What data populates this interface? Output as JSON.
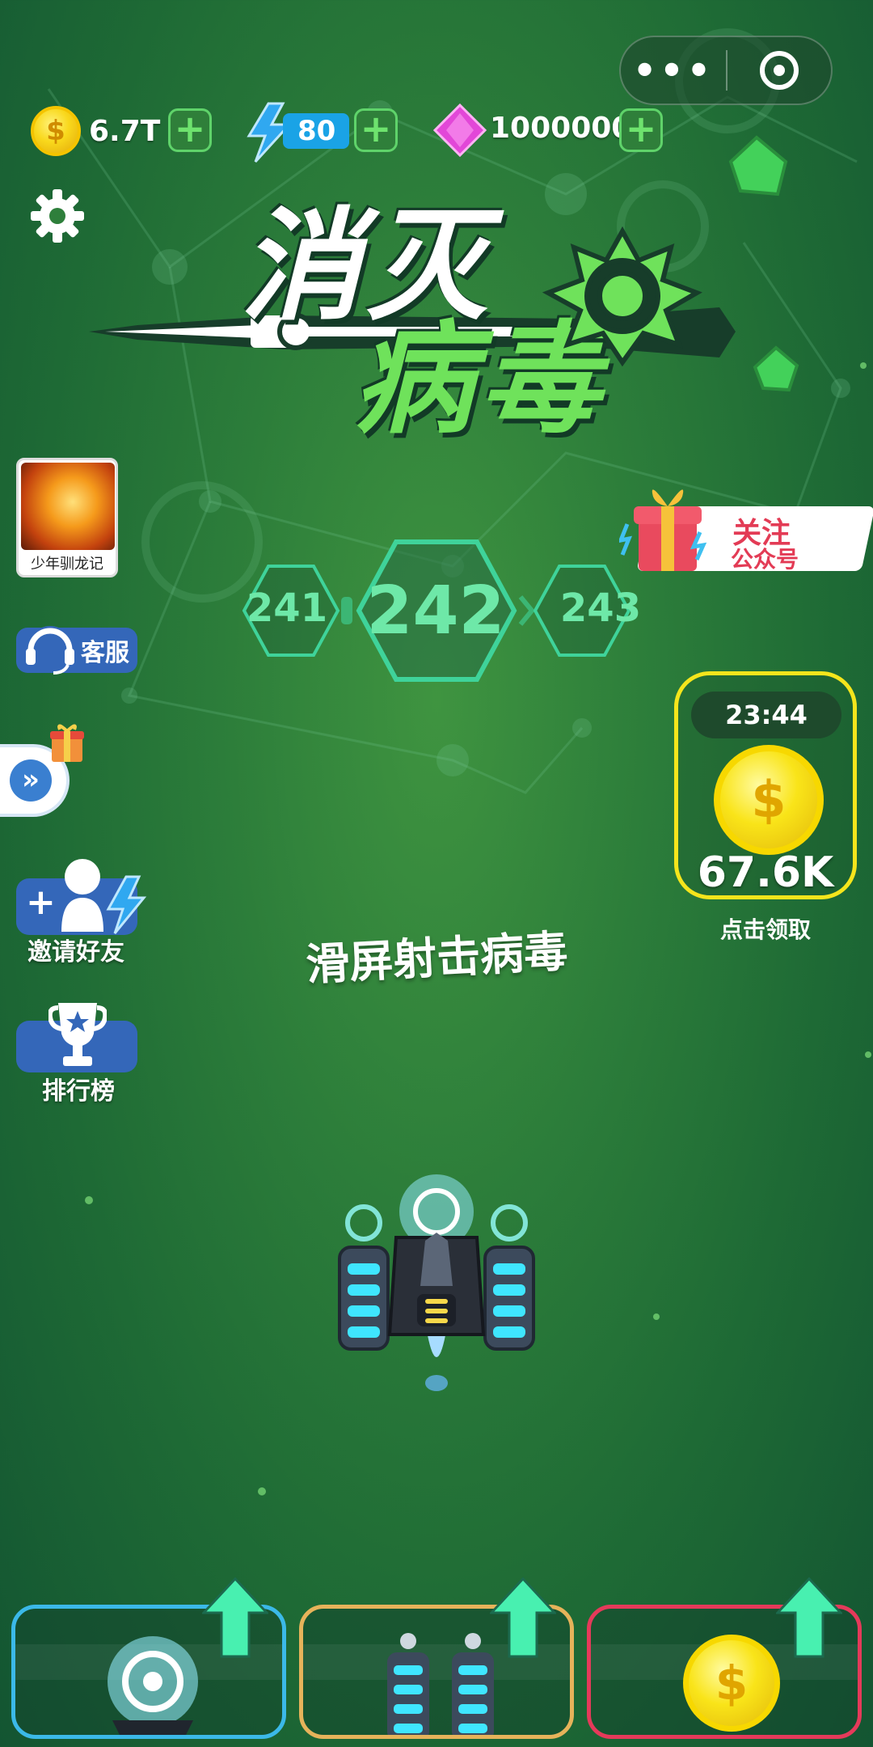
{
  "resources": {
    "coins": "6.7T",
    "energy": "80",
    "gems": "1000000"
  },
  "title": {
    "line1": "消灭",
    "line2": "病毒"
  },
  "side": {
    "game_caption": "少年驯龙记",
    "service_label": "客服",
    "invite_label": "邀请好友",
    "rank_label": "排行榜"
  },
  "follow": {
    "line1": "关注",
    "line2": "公众号"
  },
  "levels": {
    "prev": "241",
    "current": "242",
    "next": "243"
  },
  "reward": {
    "timer": "23:44",
    "amount": "67.6K",
    "caption": "点击领取"
  },
  "hint": "滑屏射击病毒",
  "icons": {
    "coin": "dollar-coin-icon",
    "energy": "lightning-icon",
    "gem": "gem-icon",
    "settings": "gear-icon"
  },
  "colors": {
    "upgrade_fire": "#3bb9e8",
    "upgrade_weapon": "#e6b35a",
    "upgrade_coin": "#e53a5a",
    "reward_border": "#f5e51c",
    "level_text": "#6ee8a8"
  }
}
